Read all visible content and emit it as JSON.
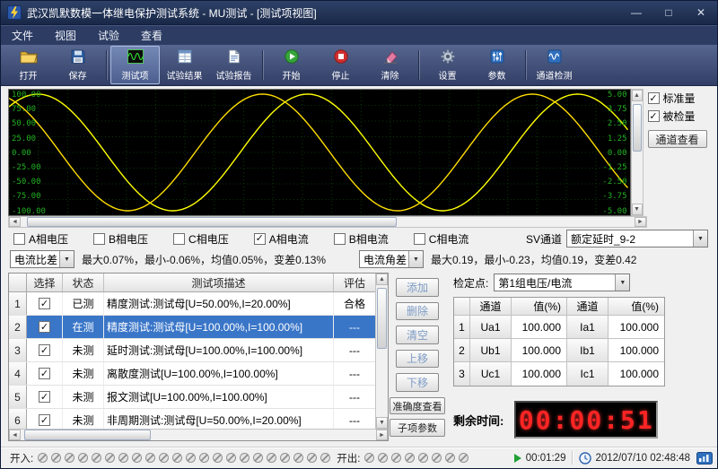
{
  "window": {
    "title": "武汉凯默数模一体继电保护测试系统 - MU测试 - [测试项视图]",
    "minimize": "—",
    "maximize": "□",
    "close": "✕"
  },
  "menu": {
    "items": [
      "文件",
      "视图",
      "试验",
      "查看"
    ]
  },
  "toolbar": {
    "open": "打开",
    "save": "保存",
    "test_items": "测试项",
    "test_results": "试验结果",
    "test_report": "试验报告",
    "start": "开始",
    "stop": "停止",
    "clear": "清除",
    "settings": "设置",
    "params": "参数",
    "channel_check": "通道检测"
  },
  "chart": {
    "left_axis": [
      "100.00",
      "75.00",
      "50.00",
      "25.00",
      "0.00",
      "-25.00",
      "-50.00",
      "-75.00",
      "-100.00"
    ],
    "right_axis": [
      "5.00",
      "3.75",
      "2.50",
      "1.25",
      "0.00",
      "-1.25",
      "-2.50",
      "-3.75",
      "-5.00"
    ],
    "cycles": 2.3,
    "waves": [
      {
        "name": "standard-wave",
        "color": "#ffff00",
        "phase": 0.9
      },
      {
        "name": "measured-wave",
        "color": "#ffdd00",
        "phase": 1.95
      }
    ],
    "bg": "#000000",
    "grid_color": "#0a3a0a",
    "label_color": "#22b022"
  },
  "chart_side": {
    "standard_label": "标准量",
    "measured_label": "被检量",
    "channel_view_button": "通道查看"
  },
  "phase_checks": [
    {
      "label": "A相电压",
      "checked": false
    },
    {
      "label": "B相电压",
      "checked": false
    },
    {
      "label": "C相电压",
      "checked": false
    },
    {
      "label": "A相电流",
      "checked": true
    },
    {
      "label": "B相电流",
      "checked": false
    },
    {
      "label": "C相电流",
      "checked": false
    }
  ],
  "sv_channel": {
    "label": "SV通道",
    "value": "额定延时_9-2"
  },
  "stats": {
    "left_select": "电流比差",
    "left_text": "最大0.07%，最小-0.06%，均值0.05%，变差0.13%",
    "right_select": "电流角差",
    "right_text": "最大0.19，最小-0.23，均值0.19，变差0.42"
  },
  "test_table": {
    "headers": [
      "选择",
      "状态",
      "测试项描述",
      "评估"
    ],
    "selected_row": 1,
    "rows": [
      {
        "num": "1",
        "checked": true,
        "status": "已测",
        "desc": "精度测试:测试母[U=50.00%,I=20.00%]",
        "eval": "合格"
      },
      {
        "num": "2",
        "checked": true,
        "status": "在测",
        "desc": "精度测试:测试母[U=100.00%,I=100.00%]",
        "eval": "---"
      },
      {
        "num": "3",
        "checked": true,
        "status": "未测",
        "desc": "延时测试:测试母[U=100.00%,I=100.00%]",
        "eval": "---"
      },
      {
        "num": "4",
        "checked": true,
        "status": "未测",
        "desc": "离散度测试[U=100.00%,I=100.00%]",
        "eval": "---"
      },
      {
        "num": "5",
        "checked": true,
        "status": "未测",
        "desc": "报文测试[U=100.00%,I=100.00%]",
        "eval": "---"
      },
      {
        "num": "6",
        "checked": true,
        "status": "未测",
        "desc": "非周期测试:测试母[U=50.00%,I=20.00%]",
        "eval": "---"
      }
    ]
  },
  "edit_buttons": {
    "add": "添加",
    "delete": "删除",
    "clear": "清空",
    "move_up": "上移",
    "move_down": "下移"
  },
  "fixed_points": {
    "label": "检定点:",
    "select_value": "第1组电压/电流",
    "headers": [
      "通道",
      "值(%)",
      "通道",
      "值(%)"
    ],
    "rows": [
      {
        "num": "1",
        "ch1": "Ua1",
        "v1": "100.000",
        "ch2": "Ia1",
        "v2": "100.000"
      },
      {
        "num": "2",
        "ch1": "Ub1",
        "v1": "100.000",
        "ch2": "Ib1",
        "v2": "100.000"
      },
      {
        "num": "3",
        "ch1": "Uc1",
        "v1": "100.000",
        "ch2": "Ic1",
        "v2": "100.000"
      }
    ]
  },
  "actions": {
    "accuracy_view": "准确度查看",
    "sub_params": "子项参数"
  },
  "remaining": {
    "label": "剩余时间:",
    "value": "00:00:51",
    "color": "#ff2424"
  },
  "statusbar": {
    "groups": [
      {
        "label": "开入:",
        "count": 22
      },
      {
        "label": "开出:",
        "count": 8
      }
    ],
    "elapsed": "00:01:29",
    "datetime": "2012/07/10 02:48:48"
  }
}
